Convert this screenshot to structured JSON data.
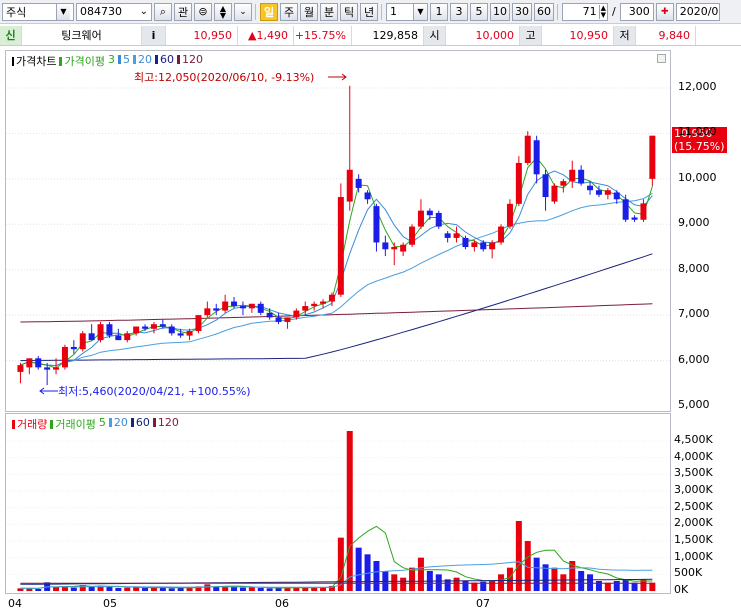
{
  "toolbar": {
    "market": "주식",
    "code": "084730",
    "btn_gwan": "관",
    "period_btns": [
      "일",
      "주",
      "월",
      "분",
      "틱",
      "년"
    ],
    "unit_value": "1",
    "num_btns": [
      "1",
      "3",
      "5",
      "10",
      "30",
      "60"
    ],
    "count_value": "71",
    "slash": "/",
    "total_value": "300",
    "date_value": "2020/0"
  },
  "infobar": {
    "sin": "신",
    "name": "팅크웨어",
    "info_btn": "i",
    "price": "10,950",
    "change": "▲1,490",
    "change_pct": "+15.75%",
    "volume": "129,858",
    "open_label": "시",
    "open": "10,000",
    "high_label": "고",
    "high": "10,950",
    "low_label": "저",
    "low": "9,840"
  },
  "colors": {
    "up": "#e8000f",
    "down": "#1a1ee8",
    "ma3": "#2fa51d",
    "ma5": "#3b8bd4",
    "ma20": "#4a9fe0",
    "ma60": "#1a237e",
    "ma120": "#7b1d3a"
  },
  "price_panel": {
    "legend": {
      "title": "가격차트",
      "ma_title": "가격이평",
      "ma_periods": [
        "3",
        "5",
        "20",
        "60",
        "120"
      ]
    },
    "y_ticks": [
      "12,000",
      "11,000",
      "10,000",
      "9,000",
      "8,000",
      "7,000",
      "6,000",
      "5,000"
    ],
    "high_note": "최고:12,050(2020/06/10, -9.13%)",
    "low_note": "최저:5,460(2020/04/21, +100.55%)",
    "current_price": "10,950",
    "current_pct": "(15.75%)"
  },
  "volume_panel": {
    "legend": {
      "title": "거래량",
      "ma_title": "거래이평",
      "ma_periods": [
        "5",
        "20",
        "60",
        "120"
      ]
    },
    "y_ticks": [
      "4,500K",
      "4,000K",
      "3,500K",
      "3,000K",
      "2,500K",
      "2,000K",
      "1,500K",
      "1,000K",
      "500K",
      "0K"
    ]
  },
  "x_ticks": [
    "04",
    "05",
    "06",
    "07"
  ],
  "chart_data": {
    "type": "candlestick",
    "ylim": [
      5000,
      12300
    ],
    "volume_ylim": [
      0,
      5000000
    ],
    "candles": [
      {
        "o": 5750,
        "h": 5950,
        "l": 5500,
        "c": 5900
      },
      {
        "o": 5850,
        "h": 6000,
        "l": 5700,
        "c": 6050
      },
      {
        "o": 6050,
        "h": 6100,
        "l": 5800,
        "c": 5850
      },
      {
        "o": 5850,
        "h": 5950,
        "l": 5460,
        "c": 5800
      },
      {
        "o": 5800,
        "h": 6050,
        "l": 5700,
        "c": 5850
      },
      {
        "o": 5850,
        "h": 6350,
        "l": 5800,
        "c": 6300
      },
      {
        "o": 6300,
        "h": 6450,
        "l": 6150,
        "c": 6250
      },
      {
        "o": 6250,
        "h": 6650,
        "l": 6200,
        "c": 6600
      },
      {
        "o": 6600,
        "h": 6800,
        "l": 6450,
        "c": 6450
      },
      {
        "o": 6450,
        "h": 6850,
        "l": 6400,
        "c": 6800
      },
      {
        "o": 6800,
        "h": 6850,
        "l": 6500,
        "c": 6550
      },
      {
        "o": 6550,
        "h": 6700,
        "l": 6450,
        "c": 6450
      },
      {
        "o": 6450,
        "h": 6650,
        "l": 6400,
        "c": 6600
      },
      {
        "o": 6600,
        "h": 6750,
        "l": 6550,
        "c": 6750
      },
      {
        "o": 6750,
        "h": 6800,
        "l": 6650,
        "c": 6700
      },
      {
        "o": 6700,
        "h": 6850,
        "l": 6600,
        "c": 6800
      },
      {
        "o": 6800,
        "h": 6900,
        "l": 6700,
        "c": 6750
      },
      {
        "o": 6750,
        "h": 6800,
        "l": 6550,
        "c": 6600
      },
      {
        "o": 6600,
        "h": 6700,
        "l": 6500,
        "c": 6550
      },
      {
        "o": 6550,
        "h": 6700,
        "l": 6450,
        "c": 6650
      },
      {
        "o": 6650,
        "h": 7000,
        "l": 6600,
        "c": 7000
      },
      {
        "o": 7000,
        "h": 7300,
        "l": 6950,
        "c": 7150
      },
      {
        "o": 7150,
        "h": 7250,
        "l": 7000,
        "c": 7100
      },
      {
        "o": 7100,
        "h": 7450,
        "l": 7050,
        "c": 7300
      },
      {
        "o": 7300,
        "h": 7400,
        "l": 7150,
        "c": 7200
      },
      {
        "o": 7200,
        "h": 7300,
        "l": 7000,
        "c": 7150
      },
      {
        "o": 7150,
        "h": 7250,
        "l": 7050,
        "c": 7250
      },
      {
        "o": 7250,
        "h": 7300,
        "l": 7000,
        "c": 7050
      },
      {
        "o": 7050,
        "h": 7150,
        "l": 6900,
        "c": 6950
      },
      {
        "o": 6950,
        "h": 7050,
        "l": 6800,
        "c": 6850
      },
      {
        "o": 6850,
        "h": 6950,
        "l": 6700,
        "c": 6950
      },
      {
        "o": 6950,
        "h": 7150,
        "l": 6900,
        "c": 7100
      },
      {
        "o": 7100,
        "h": 7300,
        "l": 7000,
        "c": 7200
      },
      {
        "o": 7200,
        "h": 7300,
        "l": 7100,
        "c": 7250
      },
      {
        "o": 7250,
        "h": 7350,
        "l": 7150,
        "c": 7300
      },
      {
        "o": 7300,
        "h": 7500,
        "l": 7200,
        "c": 7450
      },
      {
        "o": 7450,
        "h": 9900,
        "l": 7400,
        "c": 9600
      },
      {
        "o": 9500,
        "h": 12050,
        "l": 9300,
        "c": 10200
      },
      {
        "o": 10000,
        "h": 10100,
        "l": 9700,
        "c": 9800
      },
      {
        "o": 9700,
        "h": 9750,
        "l": 9450,
        "c": 9550
      },
      {
        "o": 9400,
        "h": 9450,
        "l": 8400,
        "c": 8600
      },
      {
        "o": 8600,
        "h": 8750,
        "l": 8300,
        "c": 8450
      },
      {
        "o": 8450,
        "h": 8600,
        "l": 8100,
        "c": 8500
      },
      {
        "o": 8400,
        "h": 8600,
        "l": 8300,
        "c": 8550
      },
      {
        "o": 8550,
        "h": 9000,
        "l": 8500,
        "c": 8950
      },
      {
        "o": 8950,
        "h": 9550,
        "l": 8900,
        "c": 9300
      },
      {
        "o": 9300,
        "h": 9350,
        "l": 9100,
        "c": 9200
      },
      {
        "o": 9250,
        "h": 9300,
        "l": 8900,
        "c": 8950
      },
      {
        "o": 8800,
        "h": 8850,
        "l": 8600,
        "c": 8700
      },
      {
        "o": 8700,
        "h": 8950,
        "l": 8600,
        "c": 8800
      },
      {
        "o": 8700,
        "h": 8750,
        "l": 8450,
        "c": 8500
      },
      {
        "o": 8500,
        "h": 8650,
        "l": 8400,
        "c": 8600
      },
      {
        "o": 8600,
        "h": 8650,
        "l": 8400,
        "c": 8450
      },
      {
        "o": 8450,
        "h": 8650,
        "l": 8250,
        "c": 8600
      },
      {
        "o": 8600,
        "h": 9000,
        "l": 8550,
        "c": 8950
      },
      {
        "o": 8950,
        "h": 9550,
        "l": 8900,
        "c": 9450
      },
      {
        "o": 9450,
        "h": 10500,
        "l": 9400,
        "c": 10350
      },
      {
        "o": 10350,
        "h": 11050,
        "l": 10300,
        "c": 10950
      },
      {
        "o": 10850,
        "h": 10950,
        "l": 9900,
        "c": 10100
      },
      {
        "o": 10100,
        "h": 10200,
        "l": 9300,
        "c": 9600
      },
      {
        "o": 9500,
        "h": 9900,
        "l": 9450,
        "c": 9850
      },
      {
        "o": 9850,
        "h": 10000,
        "l": 9700,
        "c": 9950
      },
      {
        "o": 9950,
        "h": 10400,
        "l": 9800,
        "c": 10200
      },
      {
        "o": 10200,
        "h": 10300,
        "l": 9850,
        "c": 9900
      },
      {
        "o": 9850,
        "h": 9950,
        "l": 9650,
        "c": 9750
      },
      {
        "o": 9750,
        "h": 9850,
        "l": 9600,
        "c": 9650
      },
      {
        "o": 9650,
        "h": 9800,
        "l": 9550,
        "c": 9750
      },
      {
        "o": 9700,
        "h": 9750,
        "l": 9450,
        "c": 9550
      },
      {
        "o": 9550,
        "h": 9650,
        "l": 9050,
        "c": 9100
      },
      {
        "o": 9150,
        "h": 9200,
        "l": 9050,
        "c": 9100
      },
      {
        "o": 9100,
        "h": 9550,
        "l": 9050,
        "c": 9460
      },
      {
        "o": 10000,
        "h": 10950,
        "l": 9840,
        "c": 10950
      }
    ],
    "volume": [
      80000,
      90000,
      60000,
      260000,
      120000,
      150000,
      100000,
      180000,
      140000,
      160000,
      120000,
      90000,
      100000,
      110000,
      90000,
      120000,
      100000,
      80000,
      90000,
      100000,
      140000,
      200000,
      130000,
      150000,
      120000,
      100000,
      110000,
      90000,
      80000,
      90000,
      100000,
      120000,
      110000,
      90000,
      100000,
      150000,
      1600000,
      4800000,
      1300000,
      1100000,
      900000,
      600000,
      500000,
      400000,
      700000,
      1000000,
      600000,
      500000,
      350000,
      400000,
      300000,
      250000,
      280000,
      300000,
      500000,
      700000,
      2100000,
      1500000,
      1000000,
      800000,
      700000,
      500000,
      900000,
      600000,
      500000,
      300000,
      250000,
      300000,
      350000,
      250000,
      350000,
      250000
    ],
    "ma60_start": 6000,
    "ma60_end": 8350,
    "ma120_start": 6850,
    "ma120_end": 7250
  }
}
